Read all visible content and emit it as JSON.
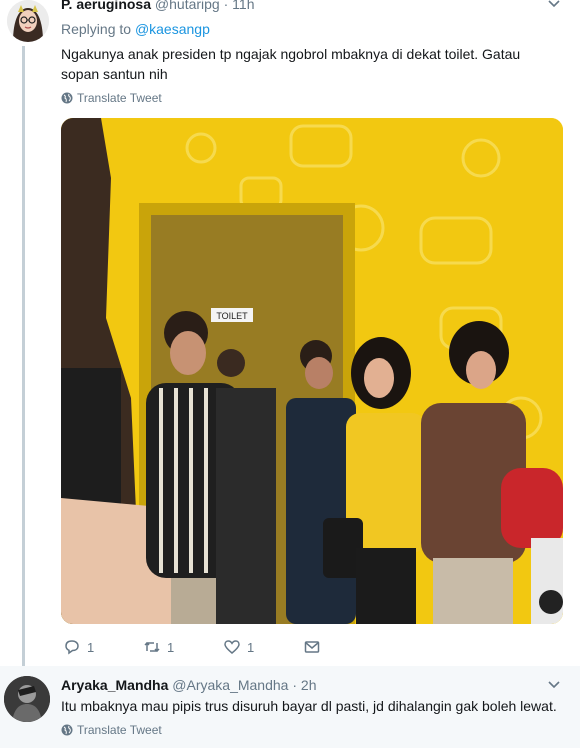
{
  "tweet1": {
    "display_name": "P. aeruginosa",
    "handle": "@hutaripg",
    "separator": "·",
    "time": "11h",
    "replying_prefix": "Replying to",
    "replying_to": "@kaesangp",
    "text": "Ngakunya anak presiden tp ngajak ngobrol mbaknya di dekat toilet. Gatau sopan santun nih",
    "translate_label": "Translate Tweet",
    "photo_sign_text": "TOILET",
    "actions": {
      "reply_count": "1",
      "retweet_count": "1",
      "like_count": "1"
    }
  },
  "tweet2": {
    "display_name": "Aryaka_Mandha",
    "handle": "@Aryaka_Mandha",
    "separator": "·",
    "time": "2h",
    "text": "Itu mbaknya mau pipis trus disuruh bayar dl pasti, jd dihalangin gak boleh lewat.",
    "translate_label": "Translate Tweet"
  },
  "icons": {
    "caret": "chevron-down-icon",
    "globe": "globe-icon",
    "reply": "reply-icon",
    "retweet": "retweet-icon",
    "like": "heart-icon",
    "dm": "envelope-icon"
  },
  "colors": {
    "link": "#1b95e0",
    "secondary_text": "#657786",
    "thread_line": "#c4cfd6",
    "photo_wall": "#f2c811"
  }
}
